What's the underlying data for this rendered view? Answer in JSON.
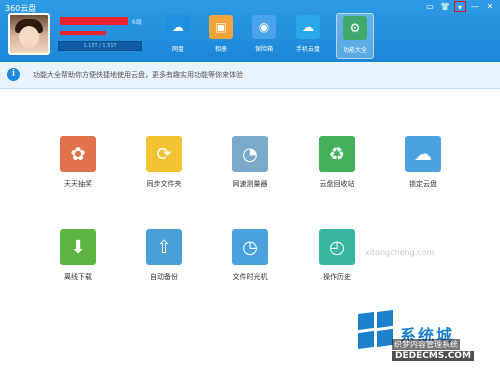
{
  "app": {
    "title": "360云盘"
  },
  "user": {
    "level": "6级",
    "storage": "1.15T / 1.51T"
  },
  "nav": [
    {
      "label": "网盘",
      "icon": "cloud-icon",
      "color": "#1f8fe0"
    },
    {
      "label": "相册",
      "icon": "photo-icon",
      "color": "#f0a43a"
    },
    {
      "label": "保险箱",
      "icon": "safe-icon",
      "color": "#4aa3e8"
    },
    {
      "label": "手机云盘",
      "icon": "phone-cloud-icon",
      "color": "#2aa7e6"
    },
    {
      "label": "功能大全",
      "icon": "toolbox-icon",
      "color": "#3fa86a"
    }
  ],
  "window_controls": [
    "▭",
    "👕",
    "▾",
    "—",
    "✕"
  ],
  "info": {
    "text": "功能大全帮助你方便快捷地使用云盘，更多有趣实用功能等你来体验"
  },
  "tiles": [
    {
      "label": "天天抽奖",
      "icon": "gift-icon",
      "color": "#e0734b",
      "glyph": "✿"
    },
    {
      "label": "同步文件夹",
      "icon": "sync-folder-icon",
      "color": "#f1c232",
      "glyph": "⟳"
    },
    {
      "label": "网速测量器",
      "icon": "speedometer-icon",
      "color": "#7aa9c9",
      "glyph": "◔"
    },
    {
      "label": "云盘回收站",
      "icon": "recycle-icon",
      "color": "#43b05c",
      "glyph": "♻"
    },
    {
      "label": "锁定云盘",
      "icon": "lock-cloud-icon",
      "color": "#4aa3e0",
      "glyph": "☁"
    },
    {
      "label": "离线下载",
      "icon": "download-icon",
      "color": "#5fb542",
      "glyph": "⬇"
    },
    {
      "label": "自动备份",
      "icon": "backup-icon",
      "color": "#4a9fd6",
      "glyph": "⇧"
    },
    {
      "label": "文件时光机",
      "icon": "time-machine-icon",
      "color": "#4aa3e0",
      "glyph": "◷"
    },
    {
      "label": "操作历史",
      "icon": "history-icon",
      "color": "#39b6a0",
      "glyph": "◴"
    }
  ],
  "watermark": {
    "brand": "系统城",
    "site": "xitongcheng.com",
    "overlay": "织梦内容管理系统",
    "domain": "DEDECMS.COM",
    "faint": "xitongcheng.com"
  }
}
